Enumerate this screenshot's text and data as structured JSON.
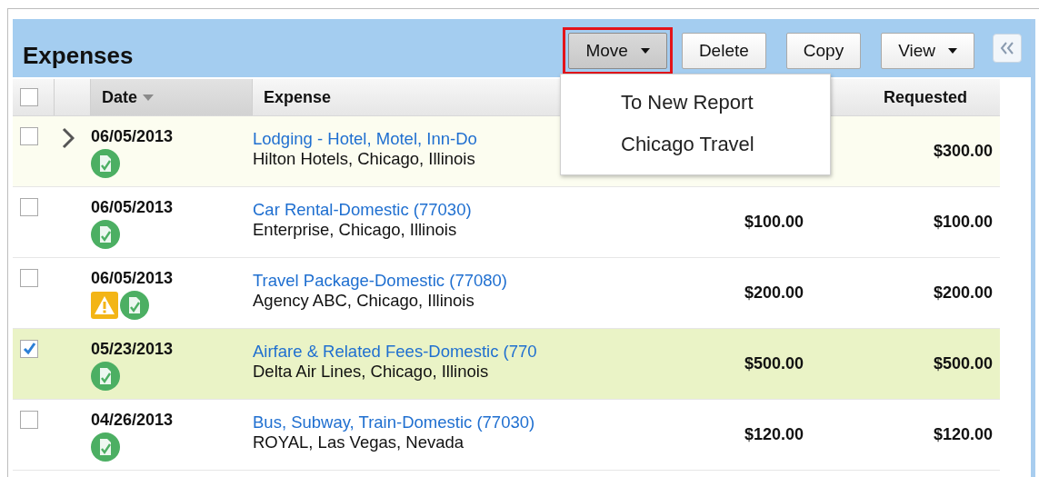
{
  "panel": {
    "title": "Expenses"
  },
  "toolbar": [
    {
      "label": "Move",
      "dropdown": true,
      "pressed": true,
      "callout": true
    },
    {
      "label": "Delete",
      "dropdown": false,
      "pressed": false,
      "callout": false
    },
    {
      "label": "Copy",
      "dropdown": false,
      "pressed": false,
      "callout": false
    },
    {
      "label": "View",
      "dropdown": true,
      "pressed": false,
      "callout": false
    }
  ],
  "menu": {
    "items": [
      "To New Report",
      "Chicago Travel"
    ]
  },
  "table": {
    "all_checked": false,
    "columns": [
      {
        "label": "Date",
        "sorted": true
      },
      {
        "label": "Expense",
        "sorted": false
      },
      {
        "label": "Requested",
        "sorted": false
      }
    ],
    "rows": [
      {
        "checked": false,
        "hovered": true,
        "expandable": true,
        "date": "06/05/2013",
        "icons": [
          {
            "kind": "receipt"
          }
        ],
        "title": "Lodging - Hotel, Motel, Inn-Do",
        "merchant": "Hilton Hotels, Chicago, Illinois",
        "requested": "$300.00"
      },
      {
        "checked": false,
        "hovered": false,
        "expandable": false,
        "date": "06/05/2013",
        "icons": [
          {
            "kind": "receipt"
          }
        ],
        "title": "Car Rental-Domestic (77030)",
        "merchant": "Enterprise, Chicago, Illinois",
        "amount": "$100.00",
        "requested": "$100.00"
      },
      {
        "checked": false,
        "hovered": false,
        "expandable": false,
        "date": "06/05/2013",
        "icons": [
          {
            "kind": "warning"
          },
          {
            "kind": "receipt"
          }
        ],
        "title": "Travel Package-Domestic (77080)",
        "merchant": "Agency ABC, Chicago, Illinois",
        "amount": "$200.00",
        "requested": "$200.00"
      },
      {
        "checked": true,
        "hovered": false,
        "expandable": false,
        "date": "05/23/2013",
        "icons": [
          {
            "kind": "receipt"
          }
        ],
        "title": "Airfare & Related Fees-Domestic (770",
        "merchant": "Delta Air Lines, Chicago, Illinois",
        "amount": "$500.00",
        "requested": "$500.00"
      },
      {
        "checked": false,
        "hovered": false,
        "expandable": false,
        "date": "04/26/2013",
        "icons": [
          {
            "kind": "receipt"
          }
        ],
        "title": "Bus, Subway, Train-Domestic (77030)",
        "merchant": "ROYAL, Las Vegas, Nevada",
        "amount": "$120.00",
        "requested": "$120.00"
      }
    ]
  }
}
